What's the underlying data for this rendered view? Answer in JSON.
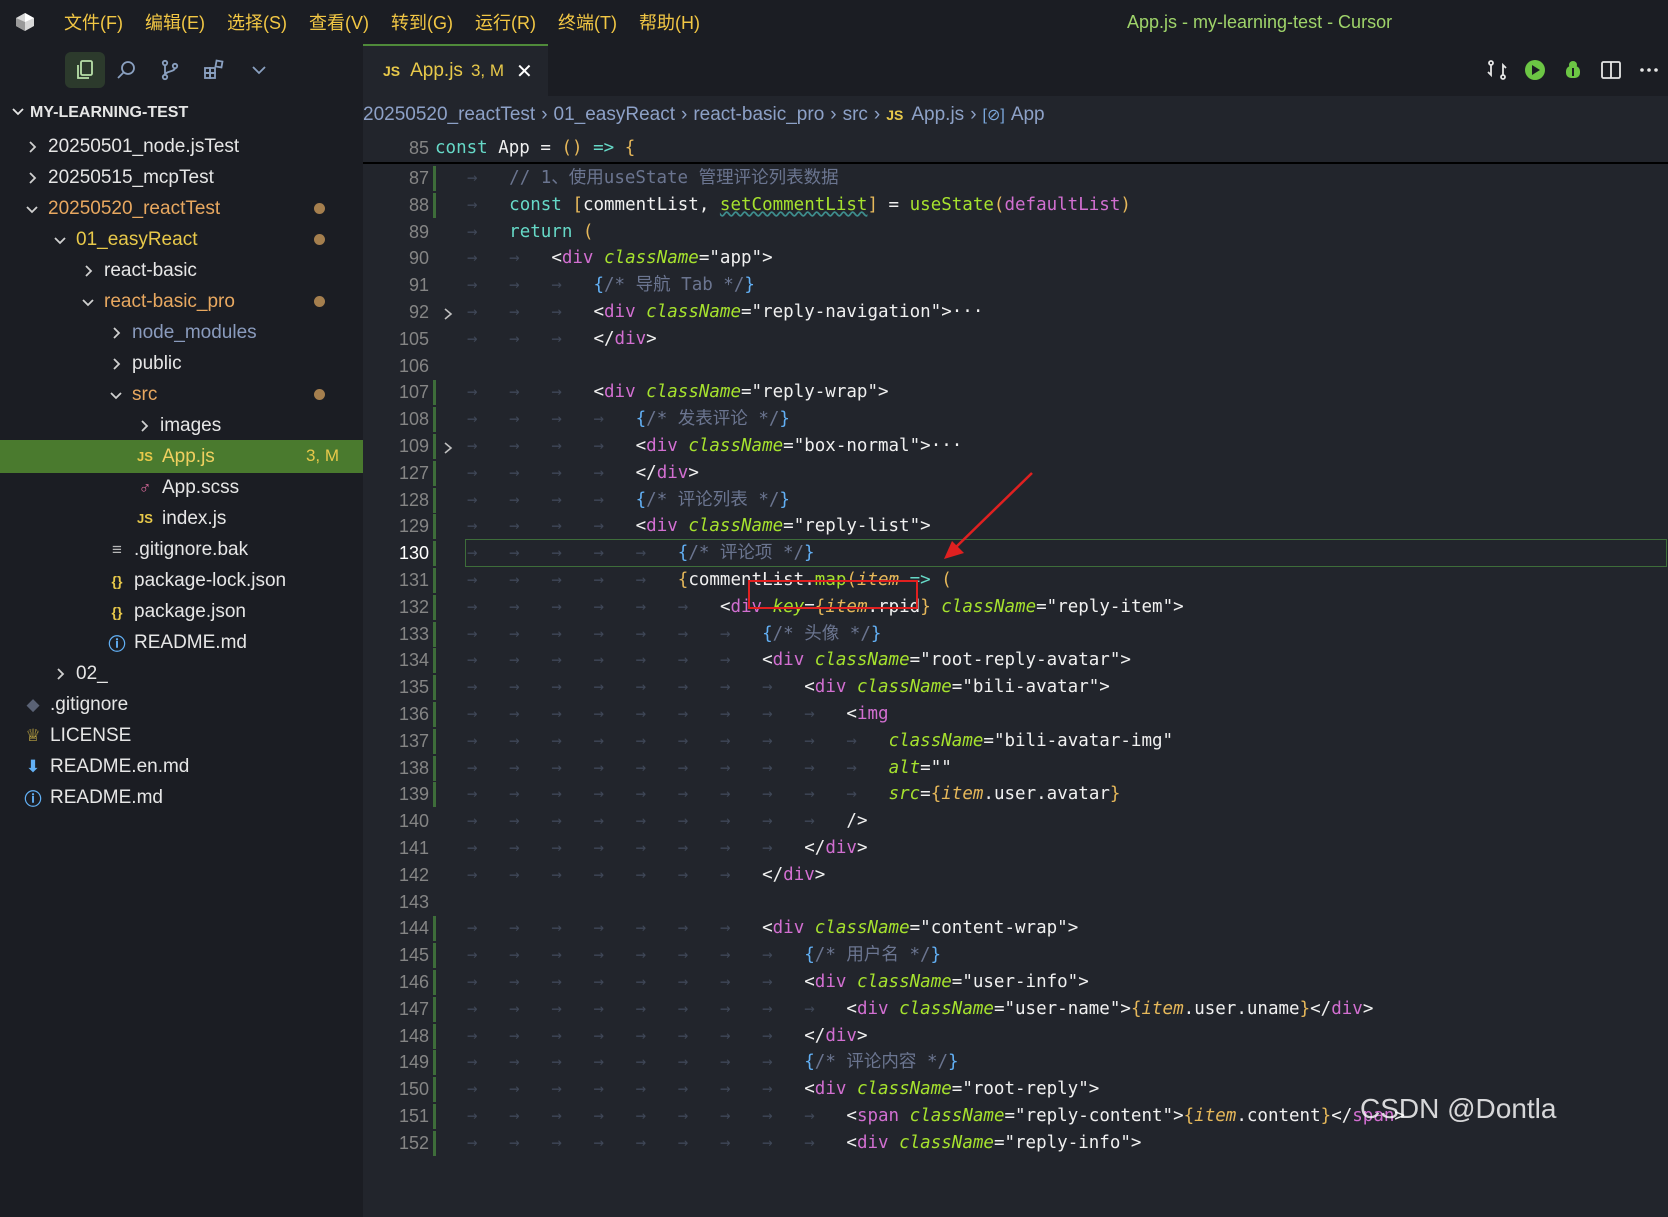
{
  "menu": [
    "文件(F)",
    "编辑(E)",
    "选择(S)",
    "查看(V)",
    "转到(G)",
    "运行(R)",
    "终端(T)",
    "帮助(H)"
  ],
  "window_title": "App.js - my-learning-test - Cursor",
  "toolbar_icons": [
    "files-icon",
    "search-icon",
    "source-control-icon",
    "extensions-icon",
    "chevron-down-icon"
  ],
  "tab": {
    "badge": "JS",
    "label": "App.js",
    "status": "3, M",
    "close": "✕"
  },
  "sidebar": {
    "root": "MY-LEARNING-TEST",
    "items": [
      {
        "label": "20250501_node.jsTest",
        "type": "folder",
        "open": false,
        "modified": false
      },
      {
        "label": "20250515_mcpTest",
        "type": "folder",
        "open": false,
        "modified": false
      },
      {
        "label": "20250520_reactTest",
        "type": "folder",
        "open": true,
        "modified": true
      },
      {
        "label": "01_easyReact",
        "type": "folder",
        "open": true,
        "modified": true
      },
      {
        "label": "react-basic",
        "type": "folder",
        "open": false,
        "modified": false
      },
      {
        "label": "react-basic_pro",
        "type": "folder",
        "open": true,
        "modified": true
      },
      {
        "label": "node_modules",
        "type": "folder",
        "open": false,
        "modified": false
      },
      {
        "label": "public",
        "type": "folder",
        "open": false,
        "modified": false
      },
      {
        "label": "src",
        "type": "folder",
        "open": true,
        "modified": true
      },
      {
        "label": "images",
        "type": "folder",
        "open": false,
        "modified": false
      },
      {
        "label": "App.js",
        "type": "js",
        "badge": "3, M",
        "selected": true
      },
      {
        "label": "App.scss",
        "type": "scss"
      },
      {
        "label": "index.js",
        "type": "js"
      },
      {
        "label": ".gitignore.bak",
        "type": "text"
      },
      {
        "label": "package-lock.json",
        "type": "json"
      },
      {
        "label": "package.json",
        "type": "json"
      },
      {
        "label": "README.md",
        "type": "info"
      },
      {
        "label": "02_",
        "type": "folder",
        "open": false
      },
      {
        "label": ".gitignore",
        "type": "git"
      },
      {
        "label": "LICENSE",
        "type": "license"
      },
      {
        "label": "README.en.md",
        "type": "download"
      },
      {
        "label": "README.md",
        "type": "info"
      }
    ]
  },
  "breadcrumb": [
    "20250520_reactTest",
    "01_easyReact",
    "react-basic_pro",
    "src",
    "App.js",
    "App"
  ],
  "breadcrumb_js": "JS",
  "breadcrumb_sym": "[⊘]",
  "editor": {
    "sticky_line": {
      "num": "85",
      "text": "const App = () => {"
    },
    "lines": [
      {
        "num": "87",
        "text": "// 1、使用useState 管理评论列表数据"
      },
      {
        "num": "88",
        "text": "const [commentList, setCommentList] = useState(defaultList)"
      },
      {
        "num": "89",
        "text": "return ("
      },
      {
        "num": "90",
        "text": "<div className=\"app\">"
      },
      {
        "num": "91",
        "text": "{/* 导航 Tab */}"
      },
      {
        "num": "92",
        "text": "<div className=\"reply-navigation\">···"
      },
      {
        "num": "105",
        "text": "</div>"
      },
      {
        "num": "106",
        "text": ""
      },
      {
        "num": "107",
        "text": "<div className=\"reply-wrap\">"
      },
      {
        "num": "108",
        "text": "{/* 发表评论 */}"
      },
      {
        "num": "109",
        "text": "<div className=\"box-normal\">···"
      },
      {
        "num": "127",
        "text": "</div>"
      },
      {
        "num": "128",
        "text": "{/* 评论列表 */}"
      },
      {
        "num": "129",
        "text": "<div className=\"reply-list\">"
      },
      {
        "num": "130",
        "text": "{/* 评论项 */}"
      },
      {
        "num": "131",
        "text": "{commentList.map(item => ("
      },
      {
        "num": "132",
        "text": "<div key={item.rpid} className=\"reply-item\">"
      },
      {
        "num": "133",
        "text": "{/* 头像 */}"
      },
      {
        "num": "134",
        "text": "<div className=\"root-reply-avatar\">"
      },
      {
        "num": "135",
        "text": "<div className=\"bili-avatar\">"
      },
      {
        "num": "136",
        "text": "<img"
      },
      {
        "num": "137",
        "text": "className=\"bili-avatar-img\""
      },
      {
        "num": "138",
        "text": "alt=\"\""
      },
      {
        "num": "139",
        "text": "src={item.user.avatar}"
      },
      {
        "num": "140",
        "text": "/>"
      },
      {
        "num": "141",
        "text": "</div>"
      },
      {
        "num": "142",
        "text": "</div>"
      },
      {
        "num": "143",
        "text": ""
      },
      {
        "num": "144",
        "text": "<div className=\"content-wrap\">"
      },
      {
        "num": "145",
        "text": "{/* 用户名 */}"
      },
      {
        "num": "146",
        "text": "<div className=\"user-info\">"
      },
      {
        "num": "147",
        "text": "<div className=\"user-name\">{item.user.uname}</div>"
      },
      {
        "num": "148",
        "text": "</div>"
      },
      {
        "num": "149",
        "text": "{/* 评论内容 */}"
      },
      {
        "num": "150",
        "text": "<div className=\"root-reply\">"
      },
      {
        "num": "151",
        "text": "<span className=\"reply-content\">{item.content}</span>"
      },
      {
        "num": "152",
        "text": "<div className=\"reply-info\">"
      }
    ]
  },
  "watermark": "CSDN @Dontla"
}
